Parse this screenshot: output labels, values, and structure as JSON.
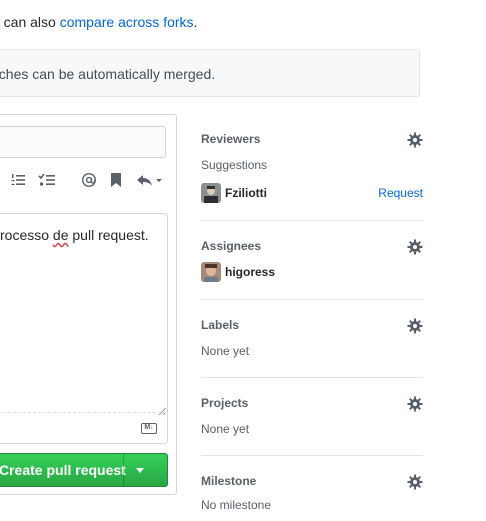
{
  "compare": {
    "prefix": "n can also ",
    "link": "compare across forks",
    "suffix": "."
  },
  "merge_status": "nches can be automatically merged.",
  "body": {
    "text_before": "rocesso ",
    "text_misspelled": "de",
    "text_after": " pull request."
  },
  "create_button": {
    "label": "Create pull request"
  },
  "sidebar": {
    "reviewers": {
      "title": "Reviewers",
      "suggestions_label": "Suggestions",
      "suggested_user": "Fziliotti",
      "request_label": "Request"
    },
    "assignees": {
      "title": "Assignees",
      "user": "higoress"
    },
    "labels": {
      "title": "Labels",
      "value": "None yet"
    },
    "projects": {
      "title": "Projects",
      "value": "None yet"
    },
    "milestone": {
      "title": "Milestone",
      "value": "No milestone"
    }
  },
  "toolbar_icons": [
    "ordered-list-icon",
    "task-list-icon",
    "mention-icon",
    "saved-reply-icon",
    "reply-icon"
  ],
  "colors": {
    "link": "#0366d6",
    "primary_button": "#28a745",
    "muted_text": "#586069"
  }
}
